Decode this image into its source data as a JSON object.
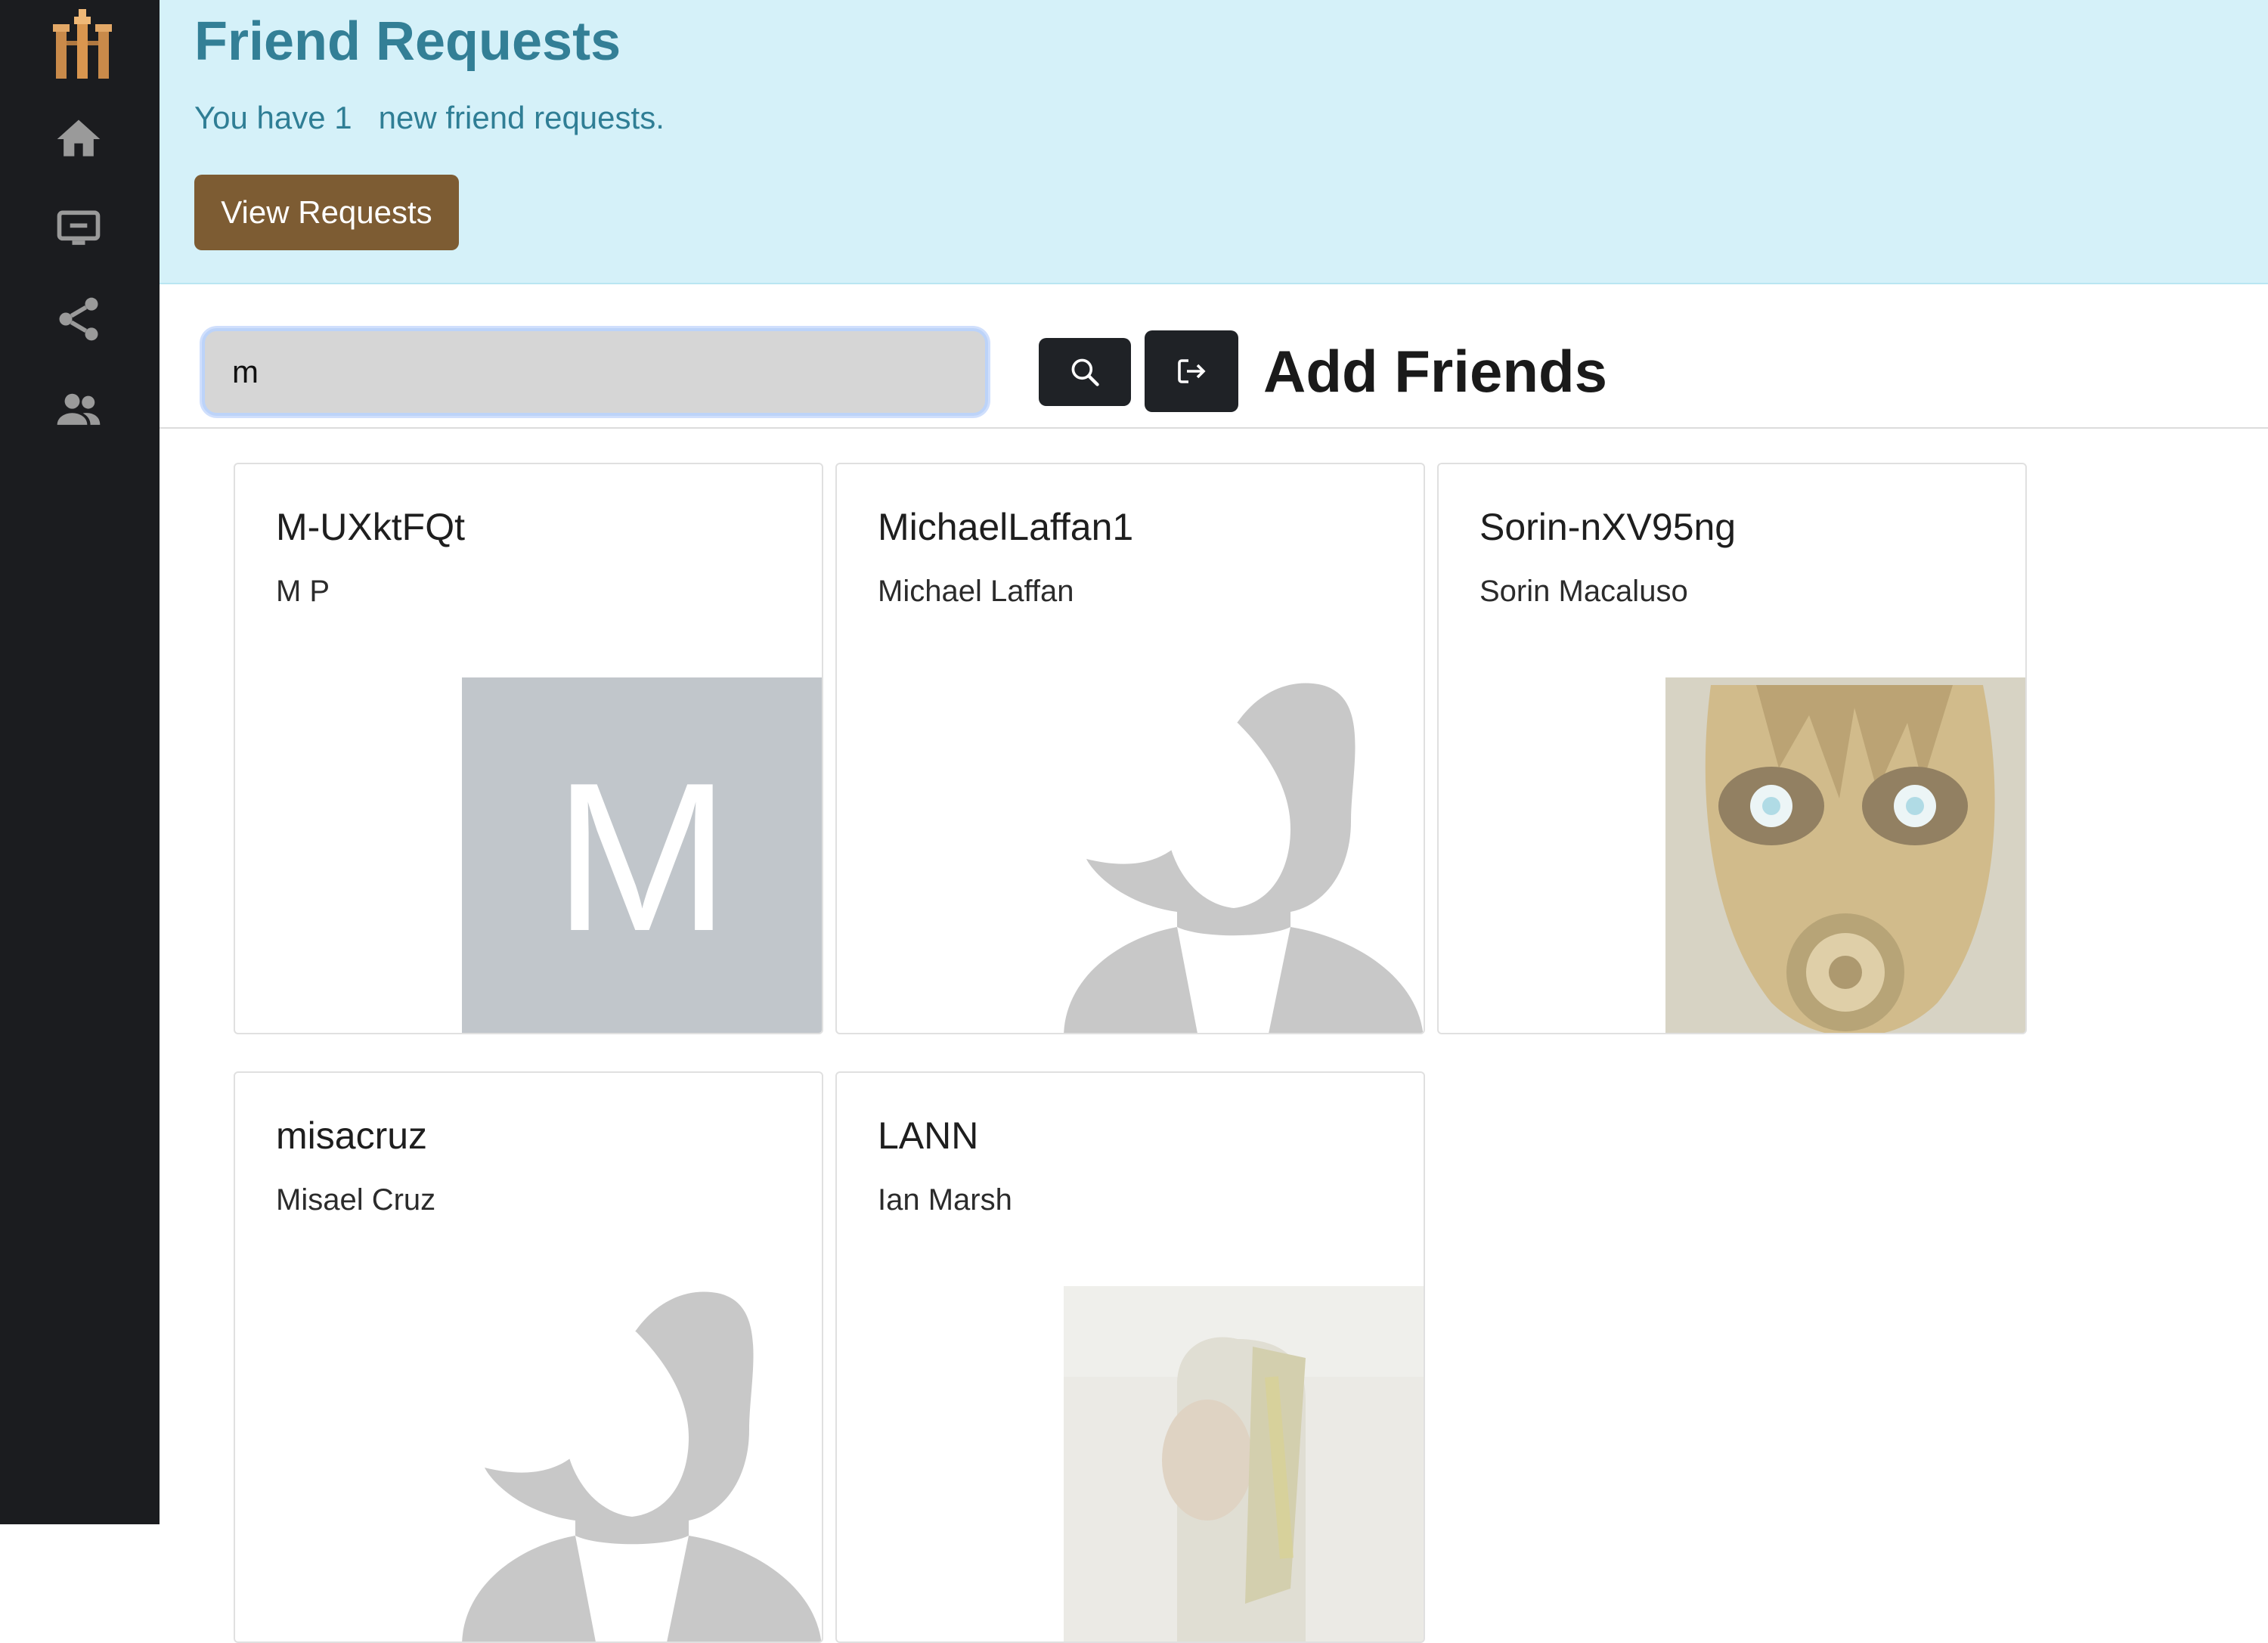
{
  "sidebar": {
    "logo": "app-logo-icon",
    "items": [
      {
        "icon": "home-icon"
      },
      {
        "icon": "monitor-icon"
      },
      {
        "icon": "share-icon"
      },
      {
        "icon": "people-icon"
      }
    ]
  },
  "friend_requests": {
    "title": "Friend Requests",
    "message": "You have 1   new friend requests.",
    "button_label": "View Requests"
  },
  "search": {
    "value": "m",
    "search_button_icon": "search-icon",
    "exit_button_icon": "exit-icon"
  },
  "add_friends": {
    "heading": "Add Friends"
  },
  "results": [
    {
      "username": "M-UXktFQt",
      "name": "M P",
      "avatar": "letter-avatar",
      "letter": "M"
    },
    {
      "username": "MichaelLaffan1",
      "name": "Michael Laffan",
      "avatar": "default-silhouette"
    },
    {
      "username": "Sorin-nXV95ng",
      "name": "Sorin Macaluso",
      "avatar": "masked-face-photo"
    },
    {
      "username": "misacruz",
      "name": "Misael Cruz",
      "avatar": "default-silhouette"
    },
    {
      "username": "LANN",
      "name": "Ian Marsh",
      "avatar": "person-photo"
    }
  ],
  "colors": {
    "sidebar_bg": "#1b1c1f",
    "banner_bg": "#d5f1f9",
    "banner_text": "#337f96",
    "button_brown": "#7d5c33",
    "dark_button": "#1f2226"
  }
}
